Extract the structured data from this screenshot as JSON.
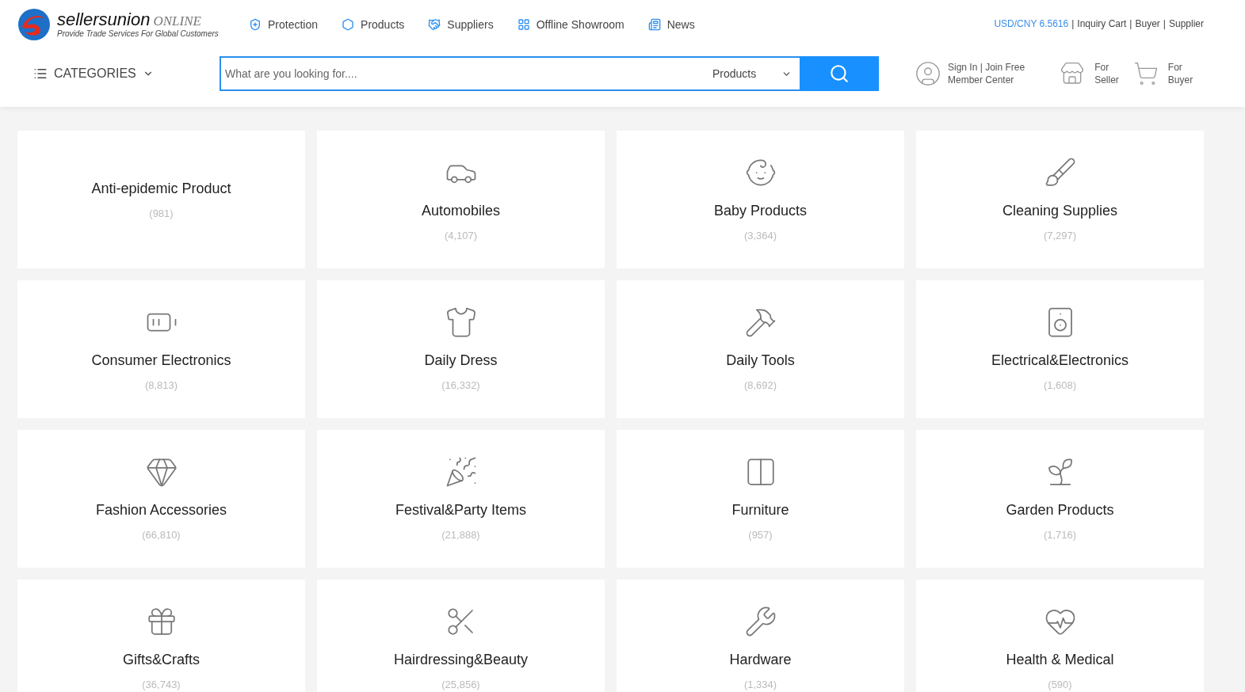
{
  "logo": {
    "name": "sellersunion",
    "suffix": "ONLINE",
    "tagline": "Provide Trade Services For Global Customers"
  },
  "nav": [
    {
      "label": "Protection"
    },
    {
      "label": "Products"
    },
    {
      "label": "Suppliers"
    },
    {
      "label": "Offline Showroom"
    },
    {
      "label": "News"
    }
  ],
  "top_links": {
    "rate": "USD/CNY 6.5616",
    "separator": "|",
    "links": [
      "Inquiry Cart",
      "Buyer",
      "Supplier"
    ]
  },
  "categories_button": "CATEGORIES",
  "search": {
    "placeholder": "What are you looking for....",
    "scope": "Products"
  },
  "account": {
    "line1": "Sign In | Join Free",
    "line2": "Member Center"
  },
  "seller": {
    "line1": "For",
    "line2": "Seller"
  },
  "buyer": {
    "line1": "For",
    "line2": "Buyer"
  },
  "cards": [
    {
      "name": "Anti-epidemic Product",
      "count": "(981)",
      "icon": false
    },
    {
      "name": "Automobiles",
      "count": "(4,107)",
      "icon": true
    },
    {
      "name": "Baby Products",
      "count": "(3,364)",
      "icon": true
    },
    {
      "name": "Cleaning Supplies",
      "count": "(7,297)",
      "icon": true
    },
    {
      "name": "Consumer Electronics",
      "count": "(8,813)",
      "icon": true
    },
    {
      "name": "Daily Dress",
      "count": "(16,332)",
      "icon": true
    },
    {
      "name": "Daily Tools",
      "count": "(8,692)",
      "icon": true
    },
    {
      "name": "Electrical&Electronics",
      "count": "(1,608)",
      "icon": true
    },
    {
      "name": "Fashion Accessories",
      "count": "(66,810)",
      "icon": true
    },
    {
      "name": "Festival&Party Items",
      "count": "(21,888)",
      "icon": true
    },
    {
      "name": "Furniture",
      "count": "(957)",
      "icon": true
    },
    {
      "name": "Garden Products",
      "count": "(1,716)",
      "icon": true
    },
    {
      "name": "Gifts&Crafts",
      "count": "(36,743)",
      "icon": true
    },
    {
      "name": "Hairdressing&Beauty",
      "count": "(25,856)",
      "icon": true
    },
    {
      "name": "Hardware",
      "count": "(1,334)",
      "icon": true
    },
    {
      "name": "Health & Medical",
      "count": "(590)",
      "icon": true
    }
  ]
}
